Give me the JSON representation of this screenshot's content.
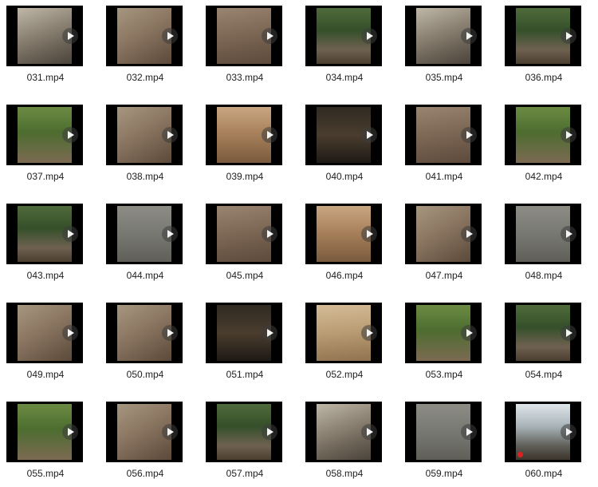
{
  "files": [
    {
      "name": "031.mp4",
      "palette": "p-trail"
    },
    {
      "name": "032.mp4",
      "palette": "p-rock"
    },
    {
      "name": "033.mp4",
      "palette": "p-dirt"
    },
    {
      "name": "034.mp4",
      "palette": "p-forest"
    },
    {
      "name": "035.mp4",
      "palette": "p-trail"
    },
    {
      "name": "036.mp4",
      "palette": "p-forest"
    },
    {
      "name": "037.mp4",
      "palette": "p-green"
    },
    {
      "name": "038.mp4",
      "palette": "p-rock"
    },
    {
      "name": "039.mp4",
      "palette": "p-sun"
    },
    {
      "name": "040.mp4",
      "palette": "p-dark"
    },
    {
      "name": "041.mp4",
      "palette": "p-dirt"
    },
    {
      "name": "042.mp4",
      "palette": "p-green"
    },
    {
      "name": "043.mp4",
      "palette": "p-forest"
    },
    {
      "name": "044.mp4",
      "palette": "p-grey"
    },
    {
      "name": "045.mp4",
      "palette": "p-dirt"
    },
    {
      "name": "046.mp4",
      "palette": "p-sun"
    },
    {
      "name": "047.mp4",
      "palette": "p-rock"
    },
    {
      "name": "048.mp4",
      "palette": "p-grey"
    },
    {
      "name": "049.mp4",
      "palette": "p-rock"
    },
    {
      "name": "050.mp4",
      "palette": "p-rock"
    },
    {
      "name": "051.mp4",
      "palette": "p-dark"
    },
    {
      "name": "052.mp4",
      "palette": "p-tan"
    },
    {
      "name": "053.mp4",
      "palette": "p-green"
    },
    {
      "name": "054.mp4",
      "palette": "p-forest"
    },
    {
      "name": "055.mp4",
      "palette": "p-green"
    },
    {
      "name": "056.mp4",
      "palette": "p-rock"
    },
    {
      "name": "057.mp4",
      "palette": "p-forest"
    },
    {
      "name": "058.mp4",
      "palette": "p-trail"
    },
    {
      "name": "059.mp4",
      "palette": "p-grey"
    },
    {
      "name": "060.mp4",
      "palette": "p-snow",
      "recording_dot": true
    }
  ],
  "play_icon": "play-icon"
}
